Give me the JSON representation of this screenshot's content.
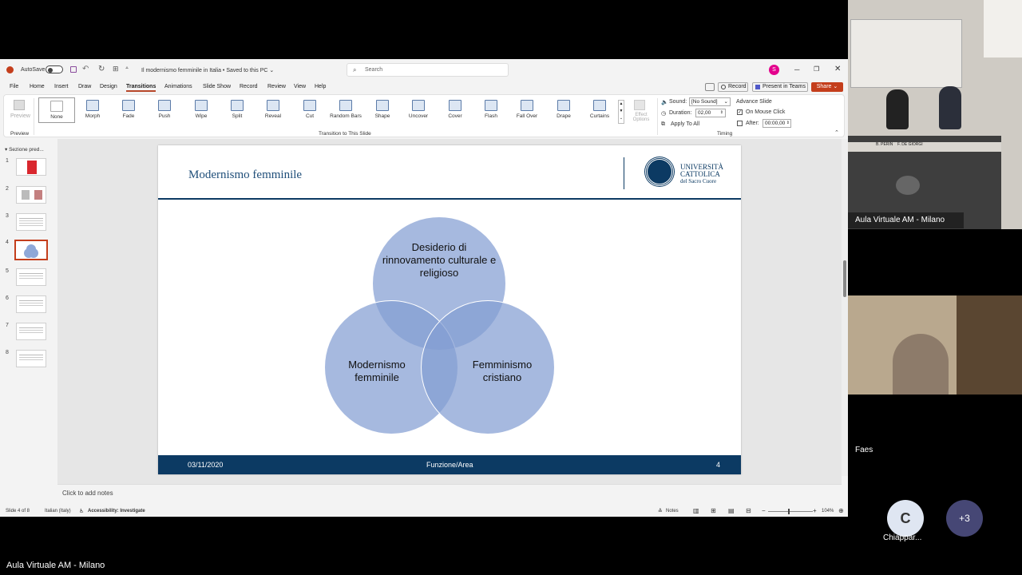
{
  "app": {
    "autosave_label": "AutoSave",
    "doc_title": "Il modernismo femminile in Italia • Saved to this PC ⌄",
    "search_placeholder": "Search",
    "user_initial": "S"
  },
  "menu": [
    "File",
    "Home",
    "Insert",
    "Draw",
    "Design",
    "Transitions",
    "Animations",
    "Slide Show",
    "Record",
    "Review",
    "View",
    "Help"
  ],
  "menu_right": {
    "record": "Record",
    "present": "Present in Teams",
    "share": "Share"
  },
  "ribbon": {
    "preview_label": "Preview",
    "group_preview": "Preview",
    "group_transition": "Transition to This Slide",
    "group_timing": "Timing",
    "effect_options": "Effect Options",
    "transitions": [
      "None",
      "Morph",
      "Fade",
      "Push",
      "Wipe",
      "Split",
      "Reveal",
      "Cut",
      "Random Bars",
      "Shape",
      "Uncover",
      "Cover",
      "Flash",
      "Fall Over",
      "Drape",
      "Curtains"
    ],
    "sound_label": "Sound:",
    "sound_value": "[No Sound]",
    "duration_label": "Duration:",
    "duration_value": "02,00",
    "apply_all": "Apply To All",
    "advance_title": "Advance Slide",
    "on_click": "On Mouse Click",
    "after_label": "After:",
    "after_value": "00:00,00"
  },
  "thumbs": {
    "section": "Sezione pred...",
    "numbers": [
      "1",
      "2",
      "3",
      "4",
      "5",
      "6",
      "7",
      "8"
    ]
  },
  "slide": {
    "title": "Modernismo femminile",
    "logo_line1": "UNIVERSITÀ",
    "logo_line2": "CATTOLICA",
    "logo_line3": "del Sacro Cuore",
    "circle_top": "Desiderio di rinnovamento culturale e religioso",
    "circle_left": "Modernismo femminile",
    "circle_right": "Femminismo cristiano",
    "footer_date": "03/11/2020",
    "footer_center": "Funzione/Area",
    "footer_page": "4"
  },
  "notes_placeholder": "Click to add notes",
  "status": {
    "slide_of": "Slide 4 of 8",
    "language": "Italian (Italy)",
    "accessibility": "Accessibility: Investigate",
    "notes": "Notes",
    "zoom": "104%"
  },
  "meeting": {
    "room_name": "Aula Virtuale AM - Milano",
    "participant2": "Faes",
    "participant3": "Chiappar...",
    "avatar_initial": "C",
    "more": "+3",
    "bottom_label": "Aula Virtuale AM - Milano",
    "nameplate1": "B. PERIN",
    "nameplate2": "F. DE GIORGI"
  },
  "colors": {
    "accent": "#b7472a",
    "navy": "#0c3a63",
    "circle": "#849ed2"
  }
}
